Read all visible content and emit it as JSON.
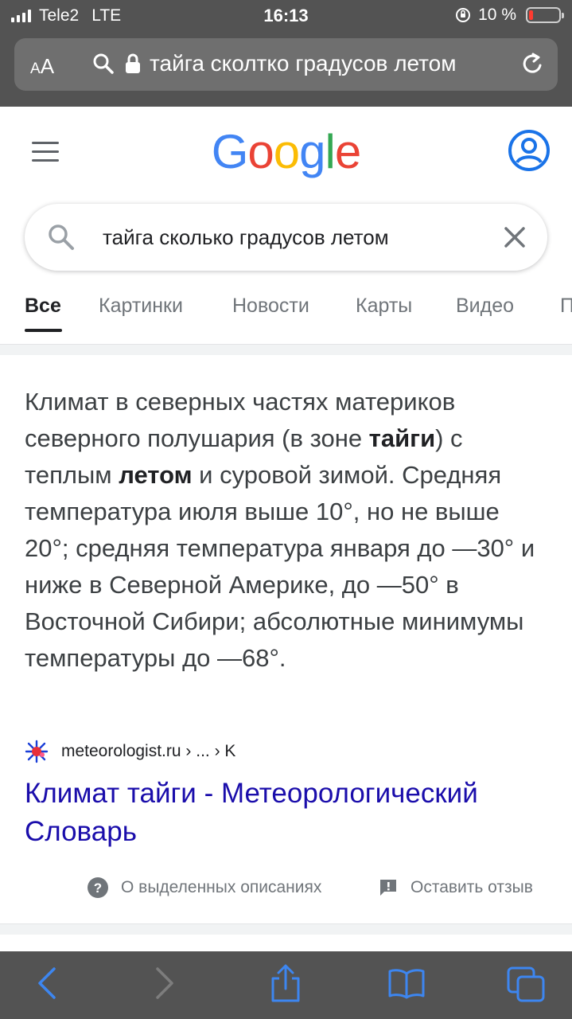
{
  "status_bar": {
    "carrier": "Tele2",
    "network": "LTE",
    "time": "16:13",
    "battery_percent": "10 %",
    "battery_level": 0.1
  },
  "address_bar": {
    "text_size_label_small": "A",
    "text_size_label_large": "A",
    "url_text": "тайга сколтко градусов летом"
  },
  "google": {
    "logo_letters": [
      "G",
      "o",
      "o",
      "g",
      "l",
      "e"
    ],
    "logo_colors": [
      "#4285f4",
      "#ea4335",
      "#fbbc05",
      "#4285f4",
      "#34a853",
      "#ea4335"
    ],
    "search_query": "тайга сколько градусов летом",
    "tabs": [
      {
        "label": "Все",
        "active": true
      },
      {
        "label": "Картинки",
        "active": false
      },
      {
        "label": "Новости",
        "active": false
      },
      {
        "label": "Карты",
        "active": false
      },
      {
        "label": "Видео",
        "active": false
      },
      {
        "label": "П",
        "active": false
      }
    ]
  },
  "snippet": {
    "part1": "Климат в северных частях материков северного полушария (в зоне ",
    "bold1": "тайги",
    "part2": ") с теплым ",
    "bold2": "летом",
    "part3": " и суровой зимой. Средняя температура июля выше 10°, но не выше 20°; средняя температура января до —30° и ниже в Северной Америке, до —50° в Восточной Сибири; абсолютные минимумы температуры до —68°.",
    "source": "meteorologist.ru › ... › K",
    "title": "Климат тайги - Метеорологический Словарь",
    "about_label": "О выделенных описаниях",
    "feedback_label": "Оставить отзыв"
  },
  "colors": {
    "link": "#1a0dab",
    "accent": "#1a73e8",
    "safari_chrome": "#535353",
    "safari_button": "#3d86f0"
  },
  "icons": {
    "address_bar": [
      "search-icon",
      "lock-icon",
      "reload-icon"
    ],
    "header": [
      "menu-icon",
      "account-icon"
    ],
    "toolbar": [
      "back-icon",
      "forward-icon",
      "share-icon",
      "bookmarks-icon",
      "tabs-icon"
    ]
  }
}
